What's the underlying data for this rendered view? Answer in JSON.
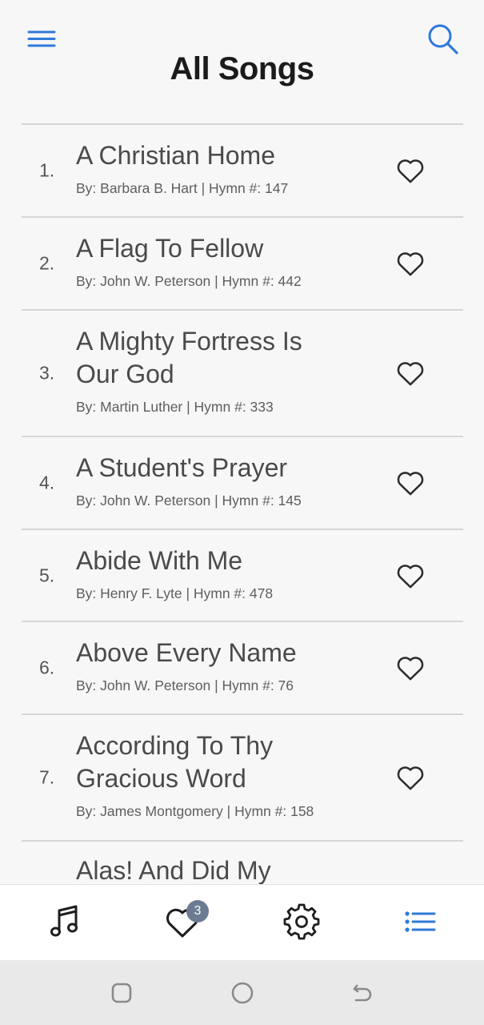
{
  "header": {
    "title": "All Songs",
    "menu_icon": "hamburger-menu-icon",
    "search_icon": "search-icon"
  },
  "colors": {
    "accent": "#2f7ad8",
    "text_dark": "#1b1b1b",
    "badge": "#6c7b92"
  },
  "songs": [
    {
      "number": "1.",
      "title": "A Christian Home",
      "subtitle": "By: Barbara B. Hart | Hymn #: 147"
    },
    {
      "number": "2.",
      "title": "A Flag To Fellow",
      "subtitle": "By: John W. Peterson | Hymn #: 442"
    },
    {
      "number": "3.",
      "title": "A Mighty Fortress Is Our God",
      "subtitle": "By: Martin Luther | Hymn #: 333"
    },
    {
      "number": "4.",
      "title": "A Student's Prayer",
      "subtitle": "By: John W. Peterson | Hymn #: 145"
    },
    {
      "number": "5.",
      "title": "Abide With Me",
      "subtitle": "By: Henry F. Lyte | Hymn #: 478"
    },
    {
      "number": "6.",
      "title": "Above Every Name",
      "subtitle": "By: John W. Peterson | Hymn #: 76"
    },
    {
      "number": "7.",
      "title": "According To Thy Gracious Word",
      "subtitle": "By: James Montgomery | Hymn #: 158"
    },
    {
      "number": "",
      "title": "Alas! And Did My",
      "subtitle": ""
    }
  ],
  "bottom_nav": {
    "items": [
      {
        "name": "songs",
        "icon": "music-note-icon"
      },
      {
        "name": "favorites",
        "icon": "heart-icon",
        "badge": "3"
      },
      {
        "name": "settings",
        "icon": "gear-icon"
      },
      {
        "name": "all-songs-list",
        "icon": "list-icon",
        "active": true
      }
    ]
  },
  "system_nav": {
    "items": [
      "recents-icon",
      "home-icon",
      "back-icon"
    ]
  }
}
